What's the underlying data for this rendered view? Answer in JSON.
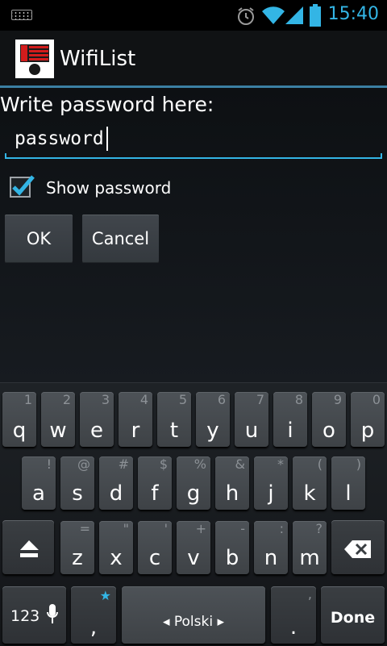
{
  "status_bar": {
    "time": "15:40",
    "icons": [
      "keyboard-notification-icon",
      "alarm-icon",
      "wifi-icon",
      "signal-icon",
      "battery-icon"
    ],
    "accent_color": "#33b5e5"
  },
  "action_bar": {
    "title": "WifiList",
    "icon": "app-logo-icon"
  },
  "dialog": {
    "prompt": "Write password here:",
    "password_value": "password",
    "show_password_label": "Show password",
    "show_password_checked": true,
    "ok_label": "OK",
    "cancel_label": "Cancel"
  },
  "keyboard": {
    "row1": [
      {
        "hint": "1",
        "key": "q"
      },
      {
        "hint": "2",
        "key": "w"
      },
      {
        "hint": "3",
        "key": "e"
      },
      {
        "hint": "4",
        "key": "r"
      },
      {
        "hint": "5",
        "key": "t"
      },
      {
        "hint": "6",
        "key": "y"
      },
      {
        "hint": "7",
        "key": "u"
      },
      {
        "hint": "8",
        "key": "i"
      },
      {
        "hint": "9",
        "key": "o"
      },
      {
        "hint": "0",
        "key": "p"
      }
    ],
    "row2": [
      {
        "hint": "!",
        "key": "a"
      },
      {
        "hint": "@",
        "key": "s"
      },
      {
        "hint": "#",
        "key": "d"
      },
      {
        "hint": "$",
        "key": "f"
      },
      {
        "hint": "%",
        "key": "g"
      },
      {
        "hint": "&",
        "key": "h"
      },
      {
        "hint": "*",
        "key": "j"
      },
      {
        "hint": "(",
        "key": "k"
      },
      {
        "hint": ")",
        "key": "l"
      }
    ],
    "row3": [
      {
        "hint": "=",
        "key": "z"
      },
      {
        "hint": "\"",
        "key": "x"
      },
      {
        "hint": "'",
        "key": "c"
      },
      {
        "hint": "+",
        "key": "v"
      },
      {
        "hint": "-",
        "key": "b"
      },
      {
        "hint": ":",
        "key": "n"
      },
      {
        "hint": "?",
        "key": "m"
      }
    ],
    "symbols_label": "123",
    "comma_key": ",",
    "comma_hint": "★",
    "space_label": "◂ Polski ▸",
    "period_key": ".",
    "period_hint": ",",
    "done_label": "Done"
  }
}
